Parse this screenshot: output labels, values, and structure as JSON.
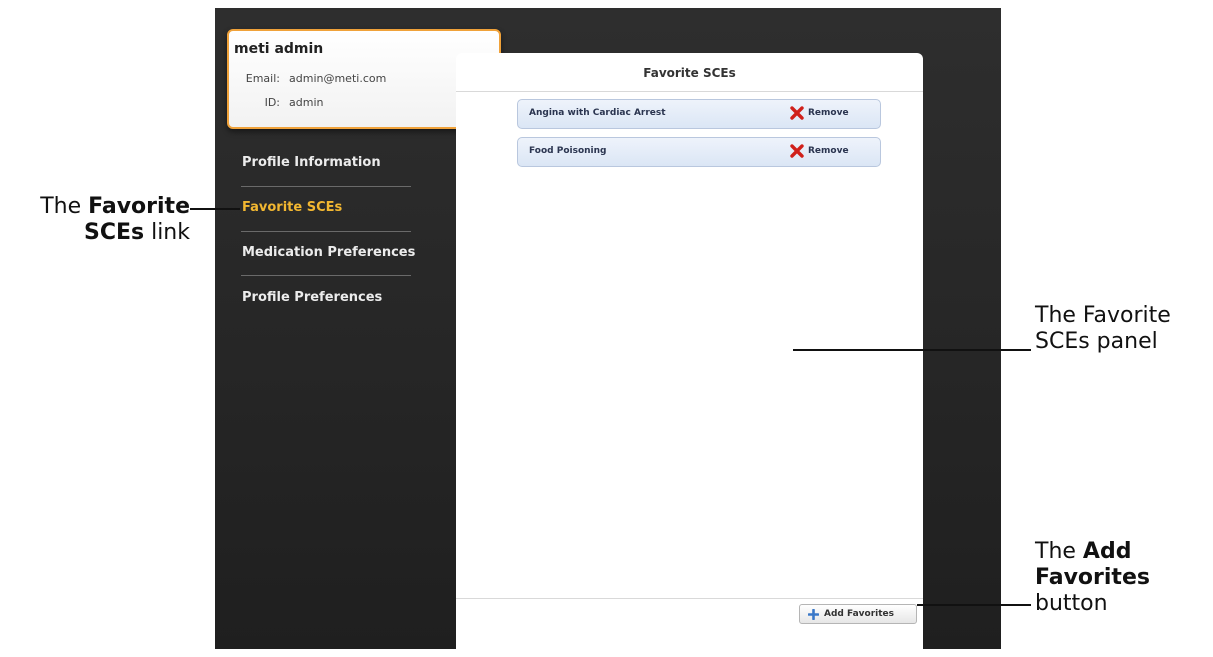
{
  "profile": {
    "name": "meti admin",
    "email_label": "Email:",
    "email_value": "admin@meti.com",
    "id_label": "ID:",
    "id_value": "admin"
  },
  "sidebar": {
    "items": [
      {
        "label": "Profile Information",
        "active": false
      },
      {
        "label": "Favorite SCEs",
        "active": true
      },
      {
        "label": "Medication Preferences",
        "active": false
      },
      {
        "label": "Profile Preferences",
        "active": false
      }
    ]
  },
  "panel": {
    "title": "Favorite SCEs",
    "favorites": [
      {
        "name": "Angina with Cardiac Arrest",
        "action": "Remove"
      },
      {
        "name": "Food Poisoning",
        "action": "Remove"
      }
    ],
    "add_button_label": "Add Favorites"
  },
  "callouts": {
    "link": {
      "prefix": "The ",
      "bold1": "Favorite",
      "bold2": "SCEs",
      "suffix": " link"
    },
    "panel": {
      "line1": "The Favorite",
      "line2": "SCEs panel"
    },
    "button": {
      "line1": "The ",
      "bold1": "Add",
      "bold2": "Favorites",
      "line3": "button"
    }
  },
  "colors": {
    "accent": "#f2b731",
    "card_border": "#f0a23a",
    "remove_red": "#d0201a",
    "add_blue": "#3a78c8"
  }
}
